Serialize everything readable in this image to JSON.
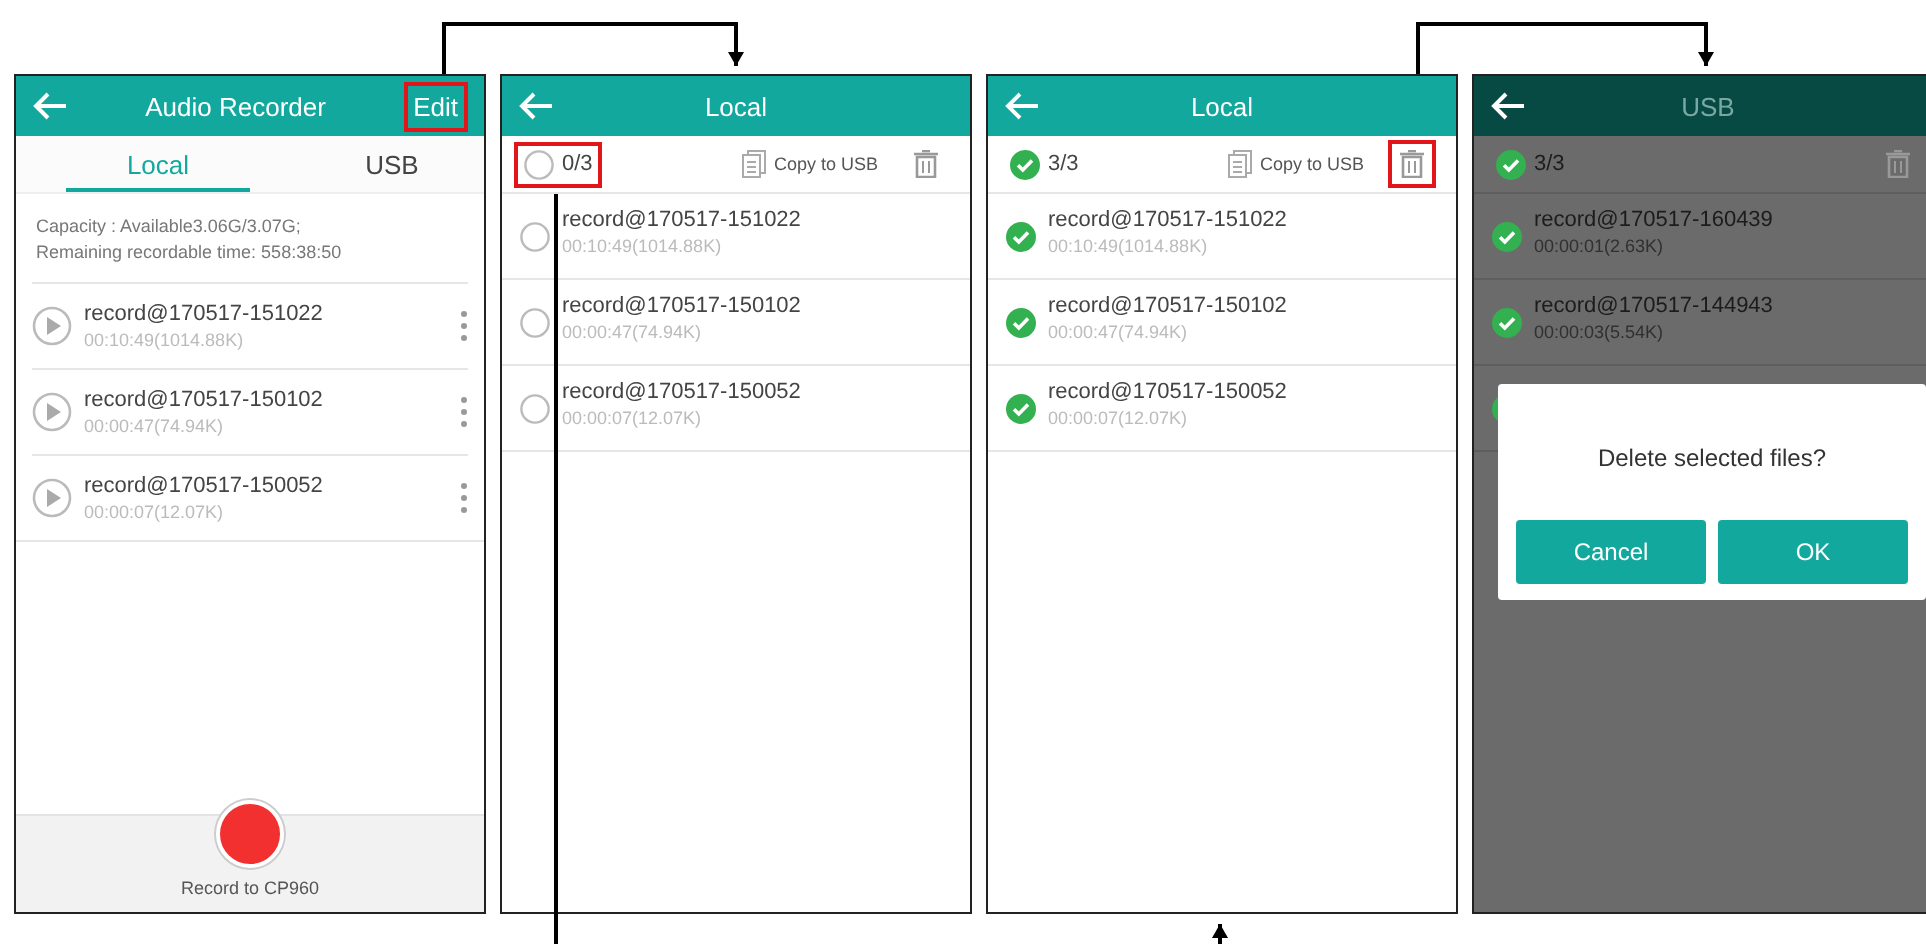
{
  "screens": [
    {
      "kind": "recorder",
      "title": "Audio Recorder",
      "action": {
        "label": "Edit",
        "highlighted": true
      },
      "dimmed": false,
      "tabs": [
        {
          "label": "Local",
          "selected": true
        },
        {
          "label": "USB",
          "selected": false
        }
      ],
      "capacity": [
        "Capacity : Available3.06G/3.07G;",
        "Remaining recordable time: 558:38:50"
      ],
      "records": [
        {
          "name": "record@170517-151022",
          "info": "00:10:49(1014.88K)"
        },
        {
          "name": "record@170517-150102",
          "info": "00:00:47(74.94K)"
        },
        {
          "name": "record@170517-150052",
          "info": "00:00:07(12.07K)"
        }
      ],
      "record_label": "Record to CP960"
    },
    {
      "kind": "select",
      "title": "Local",
      "dimmed": false,
      "select_all": {
        "count": "0/3",
        "checked": false,
        "highlighted": true
      },
      "copy_label": "Copy to USB",
      "delete_highlighted": false,
      "records": [
        {
          "name": "record@170517-151022",
          "info": "00:10:49(1014.88K)",
          "checked": false
        },
        {
          "name": "record@170517-150102",
          "info": "00:00:47(74.94K)",
          "checked": false
        },
        {
          "name": "record@170517-150052",
          "info": "00:00:07(12.07K)",
          "checked": false
        }
      ]
    },
    {
      "kind": "select",
      "title": "Local",
      "dimmed": false,
      "select_all": {
        "count": "3/3",
        "checked": true,
        "highlighted": false
      },
      "copy_label": "Copy to USB",
      "delete_highlighted": true,
      "records": [
        {
          "name": "record@170517-151022",
          "info": "00:10:49(1014.88K)",
          "checked": true
        },
        {
          "name": "record@170517-150102",
          "info": "00:00:47(74.94K)",
          "checked": true
        },
        {
          "name": "record@170517-150052",
          "info": "00:00:07(12.07K)",
          "checked": true
        }
      ]
    },
    {
      "kind": "select",
      "title": "USB",
      "dimmed": true,
      "select_all": {
        "count": "3/3",
        "checked": true,
        "highlighted": false
      },
      "delete_highlighted": false,
      "records": [
        {
          "name": "record@170517-160439",
          "info": "00:00:01(2.63K)",
          "checked": true
        },
        {
          "name": "record@170517-144943",
          "info": "00:00:03(5.54K)",
          "checked": true
        },
        {
          "checked": true
        }
      ],
      "dialog": {
        "message": "Delete selected files?",
        "buttons": [
          "Cancel",
          "OK"
        ]
      }
    }
  ]
}
